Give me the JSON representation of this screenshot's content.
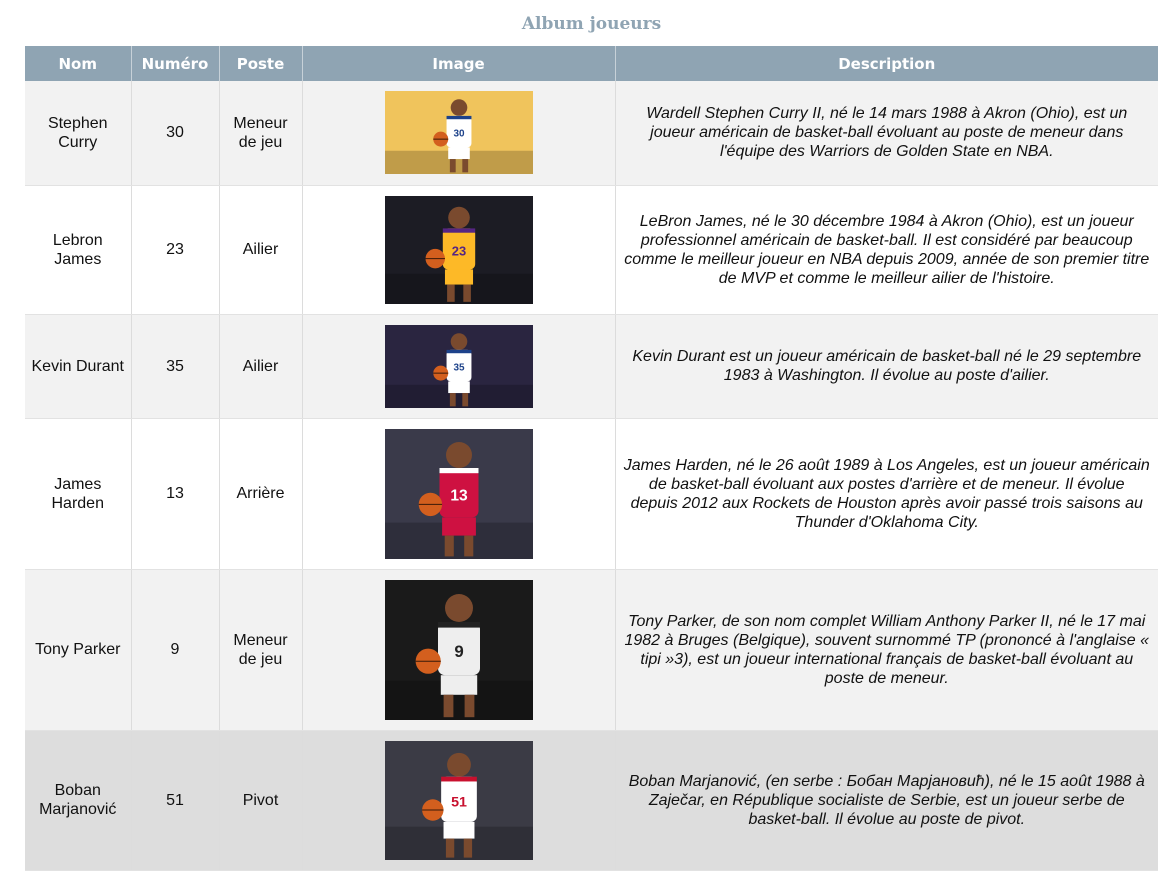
{
  "page": {
    "caption": "Album joueurs"
  },
  "table": {
    "headers": {
      "nom": "Nom",
      "numero": "Numéro",
      "poste": "Poste",
      "image": "Image",
      "description": "Description"
    },
    "rows": [
      {
        "nom": "Stephen Curry",
        "numero": "30",
        "poste": "Meneur de jeu",
        "image_icon": "stephen-curry-photo",
        "jersey_color": "#ffffff",
        "accent_color": "#1d428a",
        "bg_color": "#f0c45c",
        "description": "Wardell Stephen Curry II, né le 14 mars 1988 à Akron (Ohio), est un joueur américain de basket-ball évoluant au poste de meneur dans l'équipe des Warriors de Golden State en NBA."
      },
      {
        "nom": "Lebron James",
        "numero": "23",
        "poste": "Ailier",
        "image_icon": "lebron-james-photo",
        "jersey_color": "#fdb927",
        "accent_color": "#552583",
        "bg_color": "#1c1c24",
        "description": "LeBron James, né le 30 décembre 1984 à Akron (Ohio), est un joueur professionnel américain de basket-ball. Il est considéré par beaucoup comme le meilleur joueur en NBA depuis 2009, année de son premier titre de MVP et comme le meilleur ailier de l'histoire."
      },
      {
        "nom": "Kevin Durant",
        "numero": "35",
        "poste": "Ailier",
        "image_icon": "kevin-durant-photo",
        "jersey_color": "#ffffff",
        "accent_color": "#1d428a",
        "bg_color": "#2a2540",
        "description": "Kevin Durant est un joueur américain de basket-ball né le 29 septembre 1983 à Washington. Il évolue au poste d'ailier."
      },
      {
        "nom": "James Harden",
        "numero": "13",
        "poste": "Arrière",
        "image_icon": "james-harden-photo",
        "jersey_color": "#ce1141",
        "accent_color": "#ffffff",
        "bg_color": "#3a3a4a",
        "description": "James Harden, né le 26 août 1989 à Los Angeles, est un joueur américain de basket-ball évoluant aux postes d'arrière et de meneur. Il évolue depuis 2012 aux Rockets de Houston après avoir passé trois saisons au Thunder d'Oklahoma City."
      },
      {
        "nom": "Tony Parker",
        "numero": "9",
        "poste": "Meneur de jeu",
        "image_icon": "tony-parker-photo",
        "jersey_color": "#eeeeee",
        "accent_color": "#222222",
        "bg_color": "#1a1a1a",
        "description": "Tony Parker, de son nom complet William Anthony Parker II, né le 17 mai 1982 à Bruges (Belgique), souvent surnommé TP (prononcé à l'anglaise « tipi »3), est un joueur international français de basket-ball évoluant au poste de meneur."
      },
      {
        "nom": "Boban Marjanović",
        "numero": "51",
        "poste": "Pivot",
        "image_icon": "boban-marjanovic-photo",
        "jersey_color": "#ffffff",
        "accent_color": "#c8102e",
        "bg_color": "#3b3b45",
        "description": "Boban Marjanović, (en serbe : Бобан Марјановић), né le 15 août 1988 à Zaječar, en République socialiste de Serbie, est un joueur serbe de basket-ball. Il évolue au poste de pivot."
      }
    ]
  }
}
